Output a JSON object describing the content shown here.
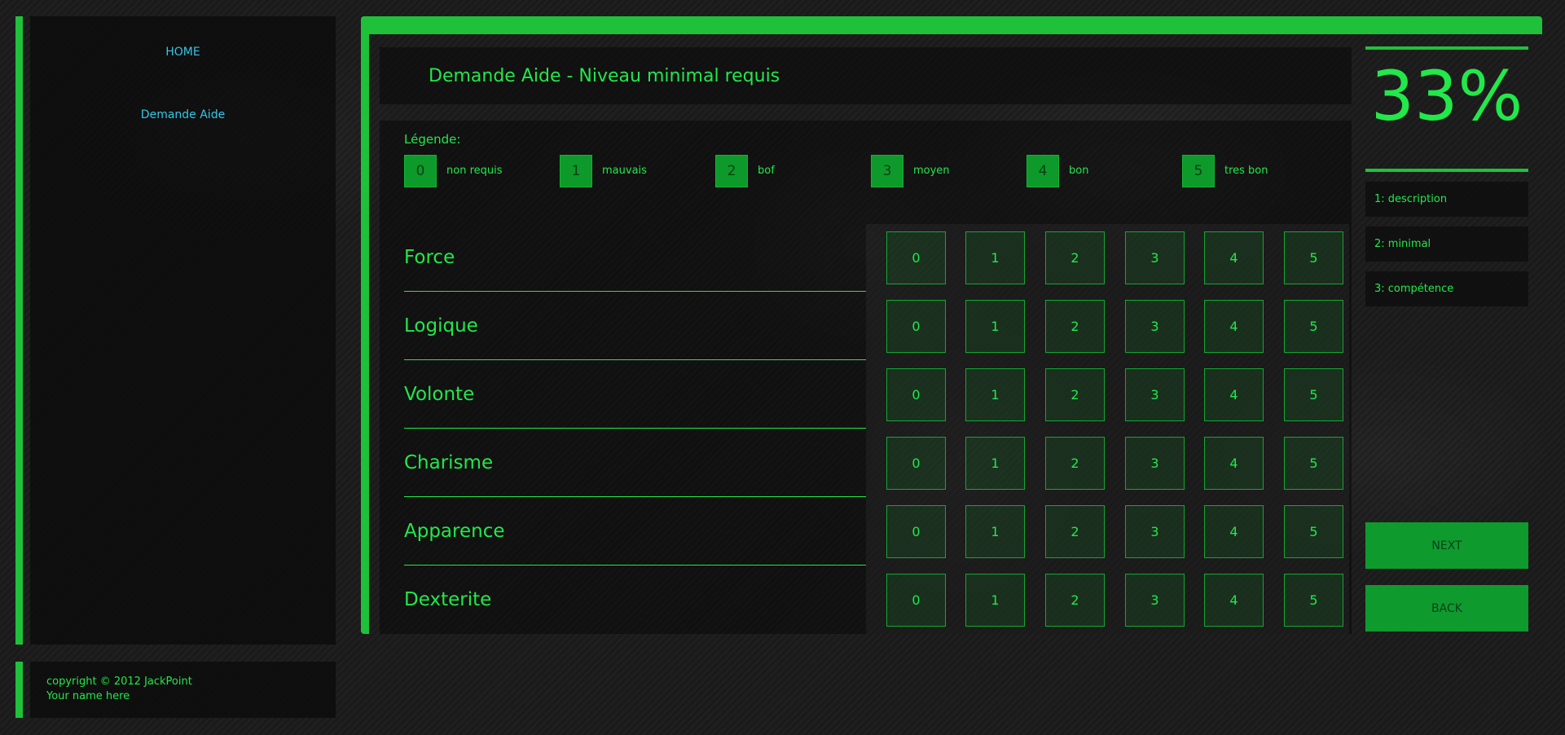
{
  "sidebar": {
    "home": "HOME",
    "demande_aide": "Demande Aide"
  },
  "footer": {
    "copyright": "copyright © 2012 JackPoint",
    "name": "Your name here"
  },
  "page": {
    "title": "Demande Aide - Niveau minimal requis"
  },
  "legend": {
    "title": "Légende:",
    "items": [
      {
        "value": "0",
        "label": "non requis"
      },
      {
        "value": "1",
        "label": "mauvais"
      },
      {
        "value": "2",
        "label": "bof"
      },
      {
        "value": "3",
        "label": "moyen"
      },
      {
        "value": "4",
        "label": "bon"
      },
      {
        "value": "5",
        "label": "tres bon"
      }
    ]
  },
  "attributes": [
    "Force",
    "Logique",
    "Volonte",
    "Charisme",
    "Apparence",
    "Dexterite"
  ],
  "ratings": [
    "0",
    "1",
    "2",
    "3",
    "4",
    "5"
  ],
  "progress": {
    "percent_text": "33%",
    "value": 0.33
  },
  "steps": [
    "1: description",
    "2: minimal",
    "3: compétence"
  ],
  "buttons": {
    "next": "NEXT",
    "back": "BACK"
  },
  "colors": {
    "accent": "#1fc13a",
    "text_green": "#22e84a",
    "link_blue": "#33c6e8",
    "button_green": "#0f9a2e"
  }
}
